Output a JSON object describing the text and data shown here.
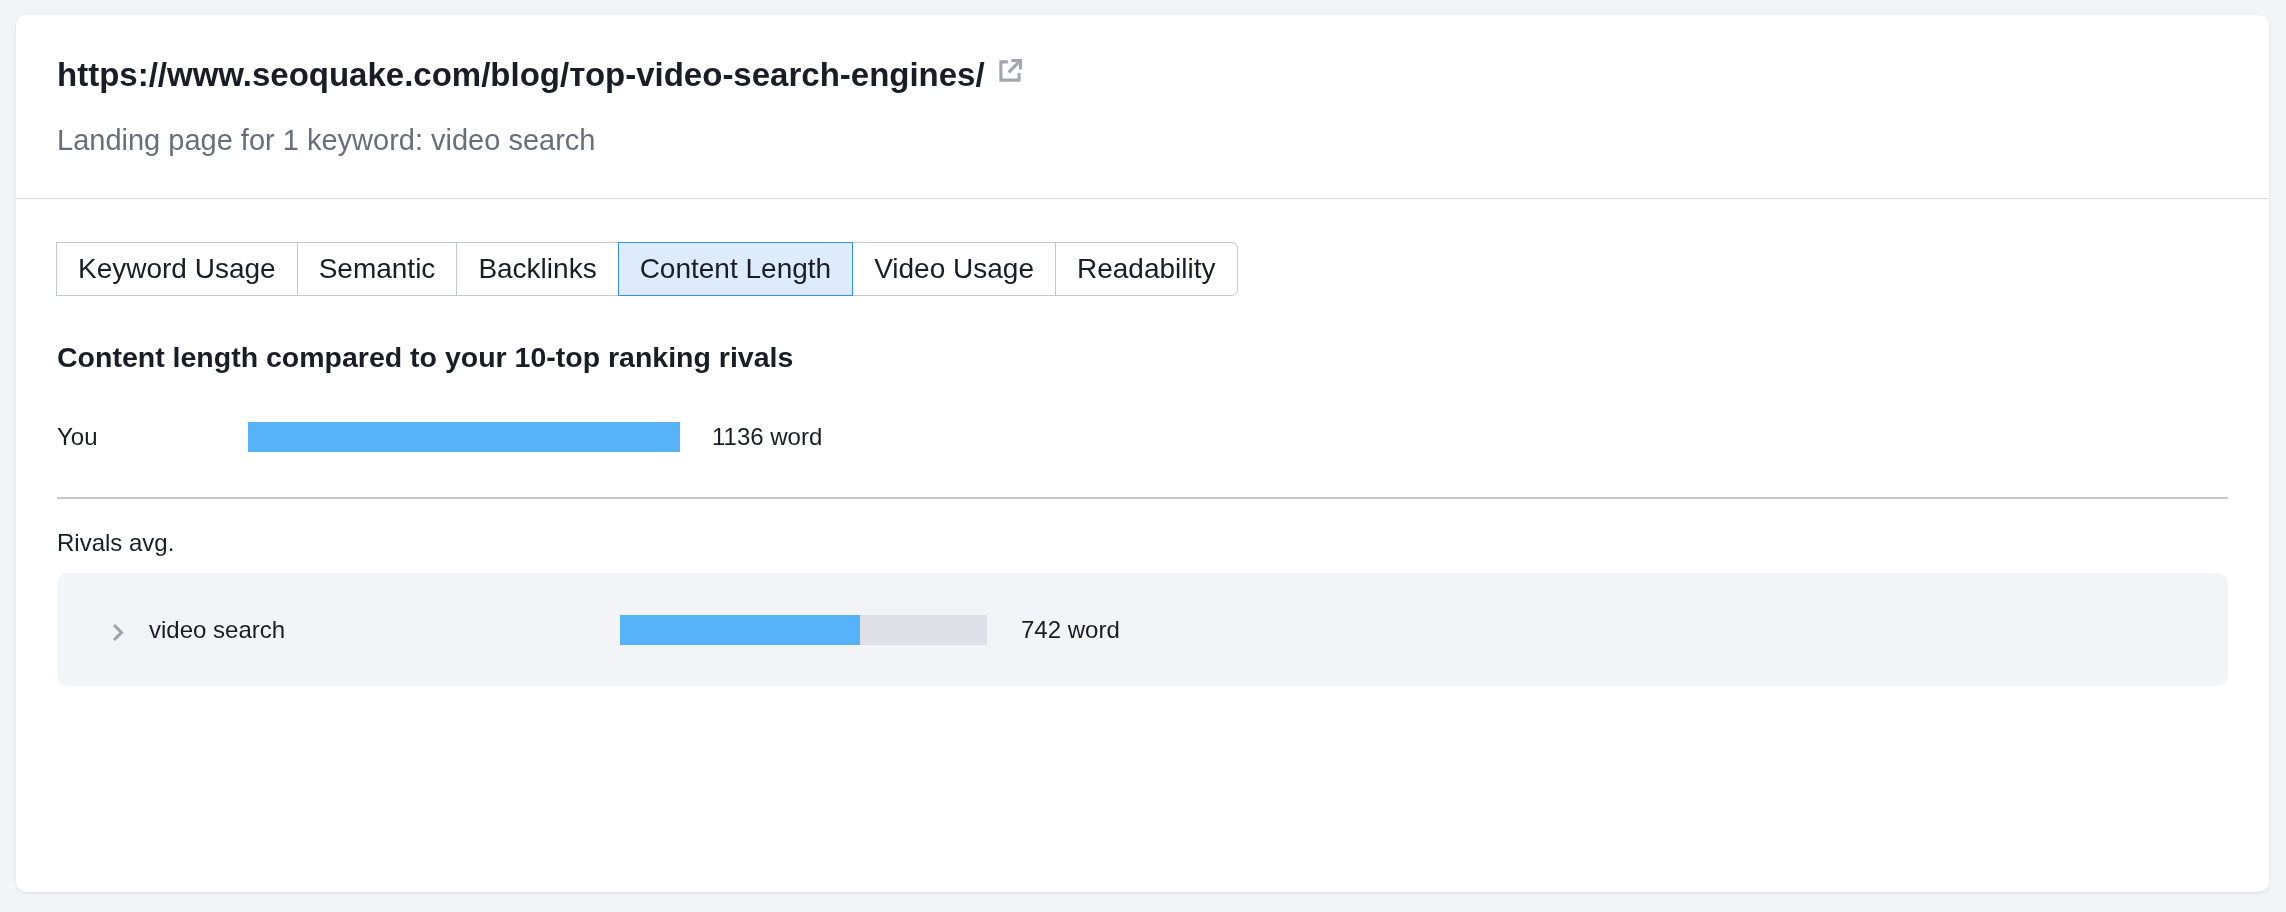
{
  "header": {
    "title": "https://www.seoquake.com/blog/тор-video-search-engines/",
    "subtitle": "Landing page for 1 keyword: video search"
  },
  "tabs": [
    {
      "label": "Keyword Usage",
      "selected": false
    },
    {
      "label": "Semantic",
      "selected": false
    },
    {
      "label": "Backlinks",
      "selected": false
    },
    {
      "label": "Content Length",
      "selected": true
    },
    {
      "label": "Video Usage",
      "selected": false
    },
    {
      "label": "Readability",
      "selected": false
    }
  ],
  "content_length": {
    "heading": "Content length compared to your 10-top ranking rivals",
    "you": {
      "label": "You",
      "reading": "1136 word"
    },
    "rivals_label": "Rivals avg.",
    "rivals": [
      {
        "keyword": "video search",
        "expanded": false,
        "level": 0.654,
        "reading": "742 word"
      }
    ]
  }
}
